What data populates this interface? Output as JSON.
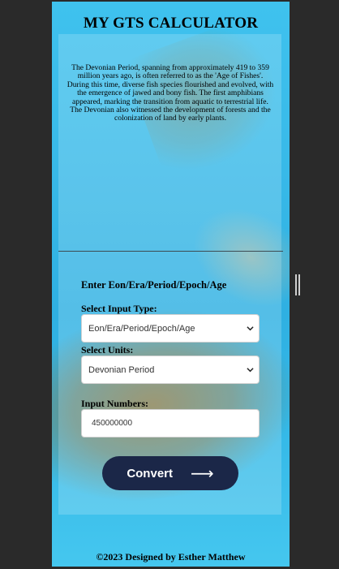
{
  "app": {
    "title": "MY GTS CALCULATOR",
    "description": "The Devonian Period, spanning from approximately 419 to 359 million years ago, is often referred to as the 'Age of Fishes'. During this time, diverse fish species flourished and evolved, with the emergence of jawed and bony fish. The first amphibians appeared, marking the transition from aquatic to terrestrial life. The Devonian also witnessed the development of forests and the colonization of land by early plants."
  },
  "form": {
    "heading": "Enter Eon/Era/Period/Epoch/Age",
    "input_type_label": "Select Input Type:",
    "input_type_value": "Eon/Era/Period/Epoch/Age",
    "units_label": "Select Units:",
    "units_value": "Devonian Period",
    "numbers_label": "Input Numbers:",
    "numbers_value": "450000000",
    "convert_label": "Convert",
    "convert_arrow": "⟶"
  },
  "footer": {
    "text": "©2023 Designed by Esther Matthew"
  },
  "colors": {
    "background": "#2a2a2a",
    "water": "#38b9e8",
    "button": "#1b2748"
  },
  "icons": {
    "dropdown": "chevron-down-icon",
    "arrow": "arrow-right-icon",
    "resize": "resize-handle-icon"
  }
}
